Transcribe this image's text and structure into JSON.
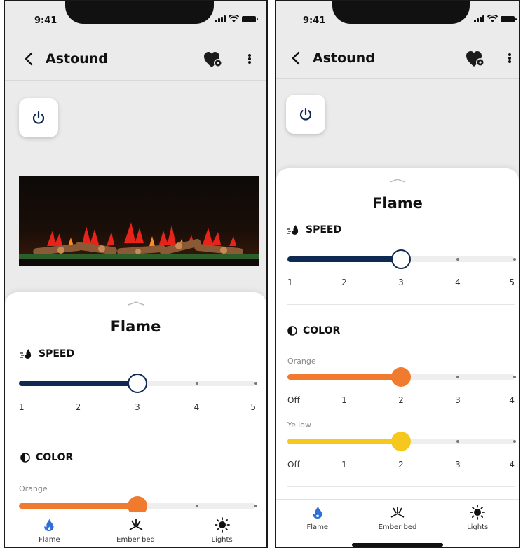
{
  "status_bar": {
    "time": "9:41"
  },
  "header": {
    "title": "Astound"
  },
  "flame_panel": {
    "title": "Flame",
    "speed": {
      "label": "SPEED",
      "value": 3,
      "ticks": [
        "1",
        "2",
        "3",
        "4",
        "5"
      ]
    },
    "color": {
      "label": "COLOR",
      "orange": {
        "label": "Orange",
        "value": 2,
        "ticks": [
          "Off",
          "1",
          "2",
          "3",
          "4"
        ]
      },
      "yellow": {
        "label": "Yellow",
        "value": 2,
        "ticks": [
          "Off",
          "1",
          "2",
          "3",
          "4"
        ]
      }
    }
  },
  "tabs": [
    {
      "label": "Flame",
      "icon": "flame-icon",
      "active": true
    },
    {
      "label": "Ember bed",
      "icon": "ember-bed-icon",
      "active": false
    },
    {
      "label": "Lights",
      "icon": "sun-icon",
      "active": false
    }
  ],
  "colors": {
    "navy": "#0f2a52",
    "orange": "#f07a2e",
    "yellow": "#f6c81e",
    "flame_blue": "#2f6fd8",
    "sheet_bg": "#ffffff",
    "screen_bg": "#ebebeb"
  }
}
